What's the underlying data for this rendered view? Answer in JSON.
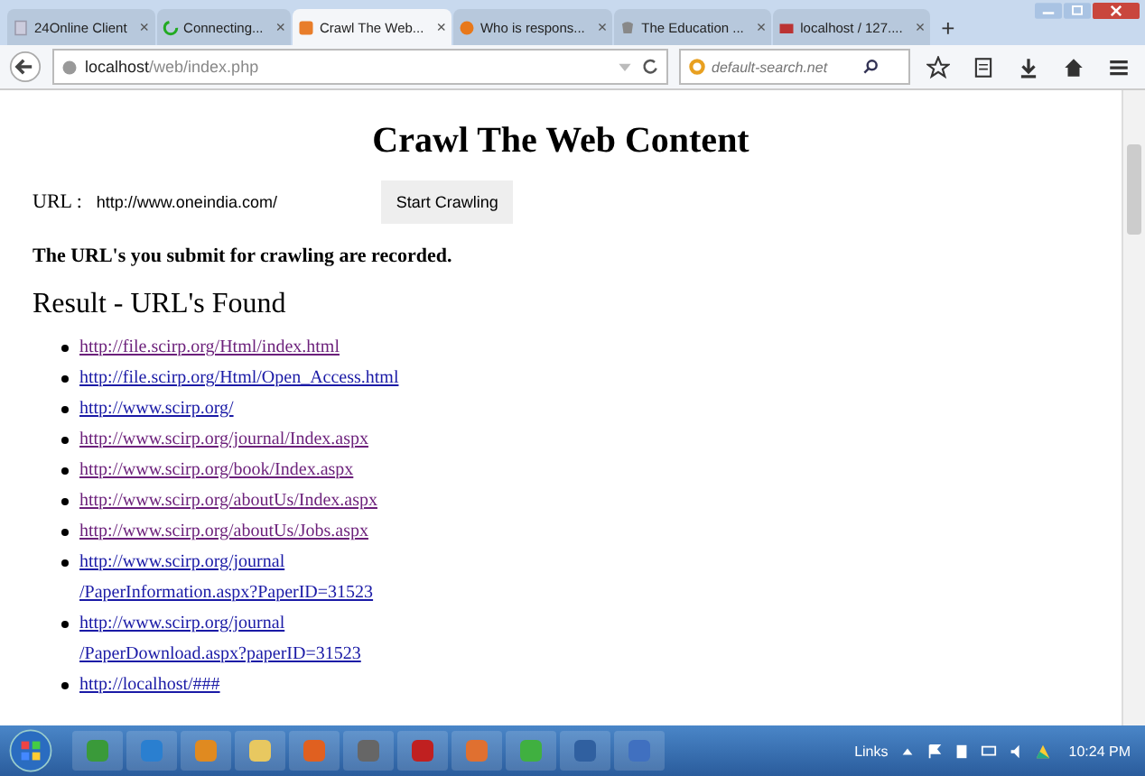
{
  "tabs": [
    {
      "title": "24Online Client",
      "selected": false
    },
    {
      "title": "Connecting...",
      "selected": false
    },
    {
      "title": "Crawl The Web...",
      "selected": true
    },
    {
      "title": "Who is respons...",
      "selected": false
    },
    {
      "title": "The Education ...",
      "selected": false
    },
    {
      "title": "localhost / 127....",
      "selected": false
    }
  ],
  "tab_close": "×",
  "new_tab": "+",
  "address": {
    "host": "localhost",
    "path": "/web/index.php"
  },
  "search": {
    "placeholder": "default-search.net"
  },
  "page": {
    "title": "Crawl The Web Content",
    "url_label": "URL :",
    "url_value": "http://www.oneindia.com/",
    "button": "Start Crawling",
    "note": "The URL's you submit for crawling are recorded.",
    "result_heading": "Result - URL's Found",
    "links": [
      {
        "lines": [
          "http://file.scirp.org/Html/index.html"
        ],
        "visited": true
      },
      {
        "lines": [
          "http://file.scirp.org/Html/Open_Access.html"
        ],
        "visited": false
      },
      {
        "lines": [
          "http://www.scirp.org/"
        ],
        "visited": false
      },
      {
        "lines": [
          "http://www.scirp.org/journal/Index.aspx"
        ],
        "visited": true
      },
      {
        "lines": [
          "http://www.scirp.org/book/Index.aspx"
        ],
        "visited": true
      },
      {
        "lines": [
          "http://www.scirp.org/aboutUs/Index.aspx"
        ],
        "visited": true
      },
      {
        "lines": [
          "http://www.scirp.org/aboutUs/Jobs.aspx"
        ],
        "visited": true
      },
      {
        "lines": [
          "http://www.scirp.org/journal",
          "/PaperInformation.aspx?PaperID=31523"
        ],
        "visited": false
      },
      {
        "lines": [
          "http://www.scirp.org/journal",
          "/PaperDownload.aspx?paperID=31523"
        ],
        "visited": false
      },
      {
        "lines": [
          "http://localhost/###"
        ],
        "visited": false
      }
    ]
  },
  "taskbar": {
    "links": "Links",
    "clock": "10:24 PM"
  }
}
